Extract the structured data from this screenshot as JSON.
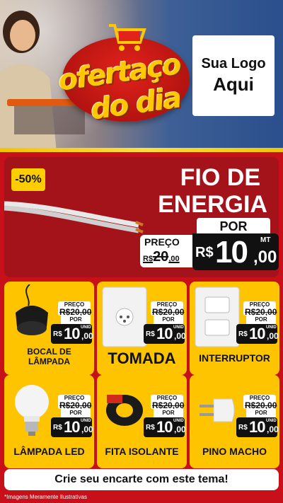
{
  "header": {
    "brand_line1": "ofertaço",
    "brand_line2": "do dia",
    "logo_line1": "Sua Logo",
    "logo_line2": "Aqui"
  },
  "featured": {
    "discount": "-50%",
    "title_line1": "FIO DE",
    "title_line2": "ENERGIA",
    "por": "POR",
    "preco_label": "PREÇO",
    "old_currency": "R$",
    "old_int": "20",
    "old_dec": ",00",
    "currency": "R$",
    "price_int": "10",
    "price_dec": ",00",
    "unit": "MT"
  },
  "products": [
    {
      "name": "BOCAL DE LÂMPADA",
      "preco_label": "PREÇO",
      "old_price": "R$20,00",
      "por": "POR",
      "currency": "R$",
      "price_int": "10",
      "price_dec": ",00",
      "unit": "UNID"
    },
    {
      "name": "TOMADA",
      "preco_label": "PREÇO",
      "old_price": "R$20,00",
      "por": "POR",
      "currency": "R$",
      "price_int": "10",
      "price_dec": ",00",
      "unit": "UNID"
    },
    {
      "name": "INTERRUPTOR",
      "preco_label": "PREÇO",
      "old_price": "R$20,00",
      "por": "POR",
      "currency": "R$",
      "price_int": "10",
      "price_dec": ",00",
      "unit": "UNID"
    },
    {
      "name": "LÂMPADA LED",
      "preco_label": "PREÇO",
      "old_price": "R$20,00",
      "por": "POR",
      "currency": "R$",
      "price_int": "10",
      "price_dec": ",00",
      "unit": "UNID"
    },
    {
      "name": "FITA ISOLANTE",
      "preco_label": "PREÇO",
      "old_price": "R$20,00",
      "por": "POR",
      "currency": "R$",
      "price_int": "10",
      "price_dec": ",00",
      "unit": "UNID"
    },
    {
      "name": "PINO MACHO",
      "preco_label": "PREÇO",
      "old_price": "R$20,00",
      "por": "POR",
      "currency": "R$",
      "price_int": "10",
      "price_dec": ",00",
      "unit": "UNID"
    }
  ],
  "cta": "Crie seu encarte com este tema!",
  "disclaimer": "*Imagens Meramente Ilustrativas",
  "colors": {
    "red": "#c8101a",
    "dark_red": "#a4121a",
    "yellow": "#ffc400",
    "black": "#111111"
  }
}
